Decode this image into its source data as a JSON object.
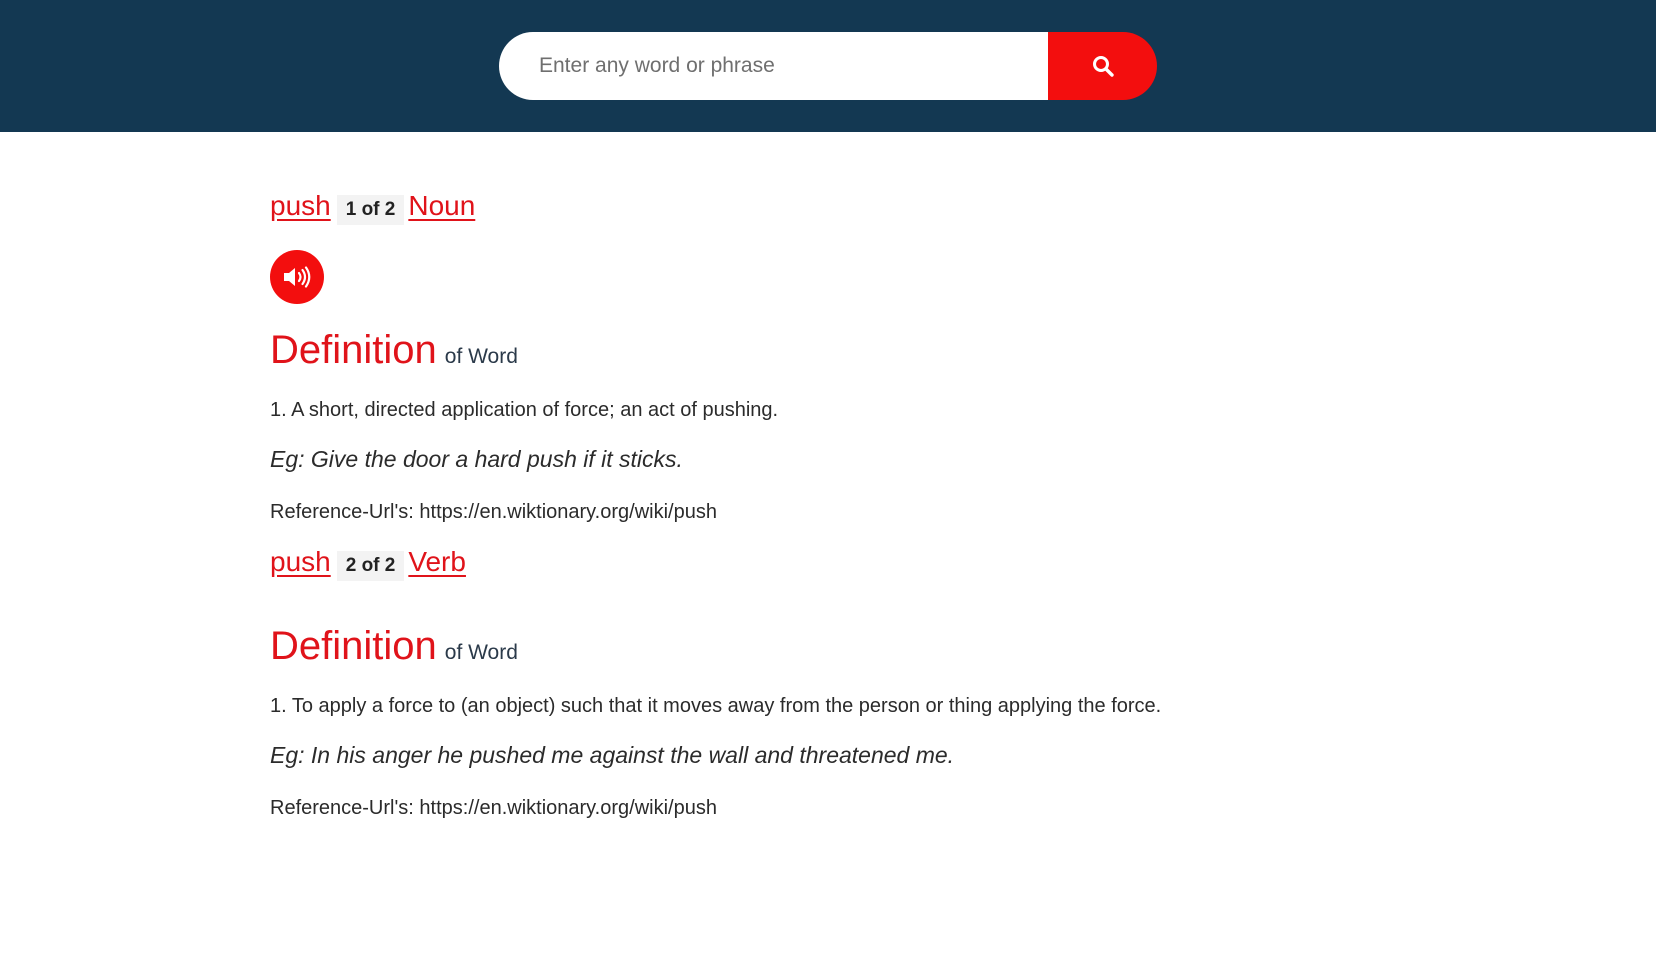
{
  "search": {
    "placeholder": "Enter any word or phrase",
    "value": ""
  },
  "icons": {
    "search": "search-icon",
    "audio": "speaker-icon"
  },
  "colors": {
    "header_bg": "#133852",
    "accent": "#f30e0e",
    "link": "#e0131a"
  },
  "entries": [
    {
      "word": "push",
      "count": "1 of 2",
      "pos": "Noun",
      "heading": "Definition",
      "heading_sub": "of Word",
      "definition": "1. A short, directed application of force; an act of pushing.",
      "example": "Eg: Give the door a hard push if it sticks.",
      "reference": "Reference-Url's: https://en.wiktionary.org/wiki/push"
    },
    {
      "word": "push",
      "count": "2 of 2",
      "pos": "Verb",
      "heading": "Definition",
      "heading_sub": "of Word",
      "definition": "1. To apply a force to (an object) such that it moves away from the person or thing applying the force.",
      "example": "Eg: In his anger he pushed me against the wall and threatened me.",
      "reference": "Reference-Url's: https://en.wiktionary.org/wiki/push"
    }
  ]
}
